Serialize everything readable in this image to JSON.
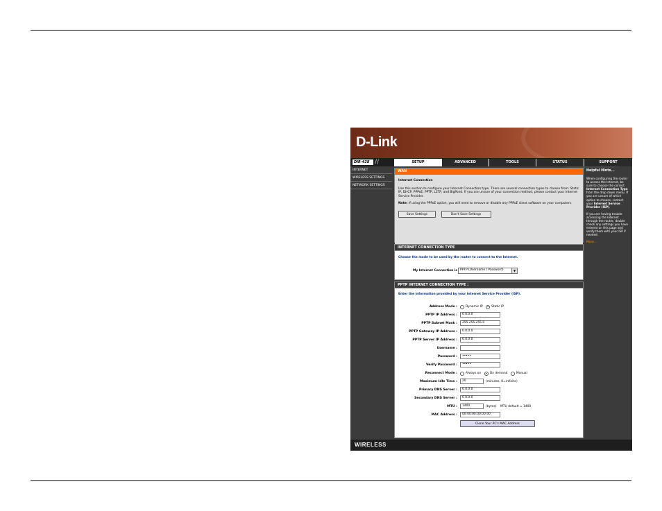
{
  "brand": {
    "logo": "D-Link",
    "model": "DIR-428",
    "slashes": "//"
  },
  "nav": {
    "tabs": [
      {
        "label": "SETUP",
        "active": true
      },
      {
        "label": "ADVANCED"
      },
      {
        "label": "TOOLS"
      },
      {
        "label": "STATUS"
      },
      {
        "label": "SUPPORT"
      }
    ]
  },
  "sidebar": {
    "items": [
      "INTERNET",
      "WIRELESS SETTINGS",
      "NETWORK SETTINGS"
    ]
  },
  "wan": {
    "title": "WAN",
    "heading": "Internet Connection",
    "desc": "Use this section to configure your Internet Connection type. There are several connection types to choose from: Static IP, DHCP, PPPoE, PPTP, L2TP, and BigPond. If you are unsure of your connection method, please contact your Internet Service Provider.",
    "note_label": "Note:",
    "note": " If using the PPPoE option, you will need to remove or disable any PPPoE client software on your computers.",
    "save_label": "Save Settings",
    "dont_save_label": "Don't Save Settings"
  },
  "conn_type": {
    "title": "INTERNET CONNECTION TYPE",
    "prompt": "Choose the mode to be used by the router to connect to the Internet.",
    "label": "My Internet Connection is :",
    "selected": "PPTP (Username / Password)"
  },
  "pptp": {
    "title": "PPTP INTERNET CONNECTION TYPE :",
    "prompt": "Enter the information provided by your Internet Service Provider (ISP).",
    "address_mode_label": "Address Mode :",
    "dynamic_label": "Dynamic IP",
    "static_label": "Static IP",
    "ip_label": "PPTP IP Address :",
    "ip": "0.0.0.0",
    "mask_label": "PPTP Subnet Mask :",
    "mask": "255.255.255.0",
    "gateway_label": "PPTP Gateway IP Address :",
    "gateway": "0.0.0.0",
    "server_label": "PPTP Server IP Address :",
    "server": "0.0.0.0",
    "username_label": "Username :",
    "username": "",
    "password_label": "Password :",
    "password": "•••••",
    "verify_label": "Verify Password :",
    "verify": "•••••",
    "reconnect_label": "Reconnect Mode :",
    "always_on": "Always on",
    "on_demand": "On demand",
    "manual": "Manual",
    "idle_label": "Maximum Idle Time :",
    "idle": "20",
    "idle_unit": "(minutes, 0=infinite)",
    "dns1_label": "Primary DNS Server :",
    "dns1": "0.0.0.0",
    "dns2_label": "Secondary DNS Server :",
    "dns2": "0.0.0.0",
    "mtu_label": "MTU :",
    "mtu": "1400",
    "mtu_unit": "(bytes)",
    "mtu_default": "MTU default = 1400",
    "mac_label": "MAC Address :",
    "mac": "00:00:00:00:00:00",
    "clone_label": "Clone Your PC's MAC Address"
  },
  "hints": {
    "title": "Helpful Hints...",
    "p1_a": "When configuring the router to access the Internet, be sure to choose the correct ",
    "p1_b": "Internet Connection Type",
    "p1_c": " from the drop down menu. If you are unsure of which option to choose, contact your ",
    "p1_d": "Internet Service Provider (ISP)",
    "p1_e": ".",
    "p2": "If you are having trouble accessing the Internet through the router, double check any settings you have entered on this page and verify them with your ISP if needed.",
    "more": "More..."
  },
  "footer": {
    "label": "WIRELESS"
  }
}
